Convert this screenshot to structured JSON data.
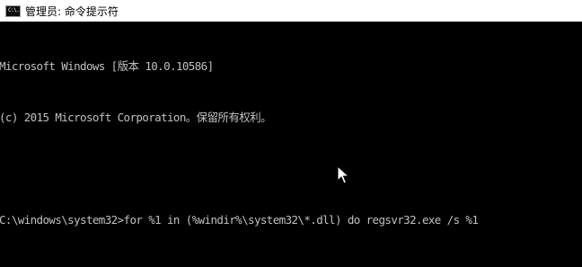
{
  "window": {
    "title": "管理员: 命令提示符",
    "icon": "cmd-icon",
    "icon_text": "C:\\."
  },
  "console": {
    "lines": [
      "Microsoft Windows [版本 10.0.10586]",
      "(c) 2015 Microsoft Corporation。保留所有权利。",
      "",
      "C:\\windows\\system32>for %1 in (%windir%\\system32\\*.dll) do regsvr32.exe /s %1"
    ],
    "text_color": "#c0c0c0",
    "background_color": "#000000"
  },
  "pointer": {
    "icon": "mouse-pointer-icon"
  }
}
